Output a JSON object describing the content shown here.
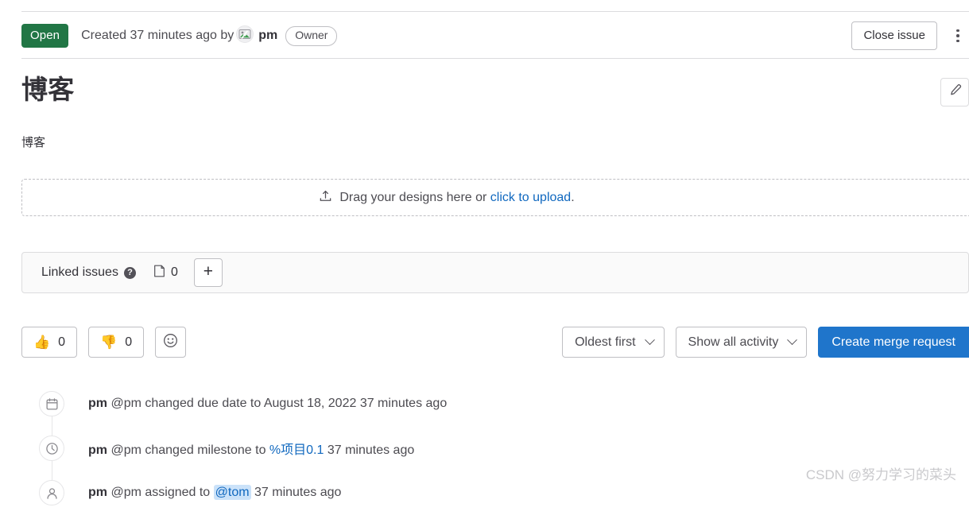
{
  "header": {
    "state_badge": "Open",
    "created_text": "Created 37 minutes ago by",
    "author": "pm",
    "author_role": "Owner",
    "close_button": "Close issue",
    "more_actions_icon": "kebab-menu-icon",
    "avatar_icon": "broken-image-avatar-icon"
  },
  "issue": {
    "title": "博客",
    "description": "博客",
    "edit_icon": "pencil-icon"
  },
  "designs": {
    "prompt_prefix": "Drag your designs here or ",
    "upload_link": "click to upload",
    "prompt_suffix": ".",
    "upload_icon": "upload-icon"
  },
  "linked_issues": {
    "label": "Linked issues",
    "help_icon": "question-mark-icon",
    "count_icon": "issue-count-icon",
    "count": "0",
    "add_button": "+",
    "add_icon": "plus-icon"
  },
  "toolbar": {
    "thumbsup_emoji": "👍",
    "thumbsup_count": "0",
    "thumbsdown_emoji": "👎",
    "thumbsdown_count": "0",
    "add_reaction_icon": "smiley-face-icon",
    "sort_label": "Oldest first",
    "filter_label": "Show all activity",
    "merge_request_label": "Create merge request",
    "merge_request_caret_icon": "chevron-down-icon"
  },
  "activity": [
    {
      "icon": "calendar-icon",
      "actor": "pm",
      "text": " @pm changed due date to August 18, 2022 37 minutes ago"
    },
    {
      "icon": "clock-icon",
      "actor": "pm",
      "text_before": " @pm changed milestone to ",
      "link": "%项目0.1",
      "text_after": " 37 minutes ago"
    },
    {
      "icon": "user-icon",
      "actor": "pm",
      "text_before": " @pm assigned to ",
      "mention": "@tom",
      "text_after": " 37 minutes ago"
    }
  ],
  "watermark": "CSDN @努力学习的菜头",
  "colors": {
    "open_green": "#217645",
    "link_blue": "#1068bf",
    "primary_blue": "#1f75cb",
    "border_gray": "#bfbfc3"
  }
}
